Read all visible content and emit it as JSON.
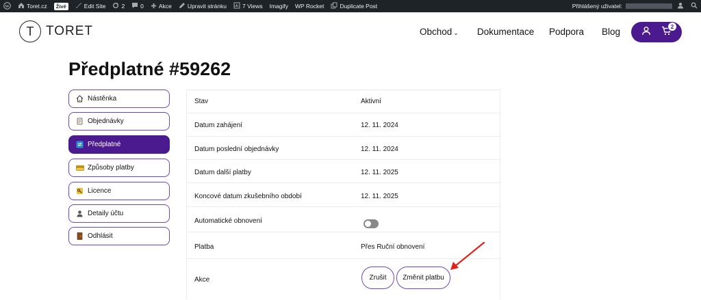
{
  "adminbar": {
    "site_name": "Toret.cz",
    "live_badge": "Živé",
    "edit_site": "Edit Site",
    "updates_count": "2",
    "comments_count": "0",
    "new_label": "Akce",
    "edit_page": "Upravit stránku",
    "views": "7 Views",
    "imagify": "Imagify",
    "wp_rocket": "WP Rocket",
    "duplicate_post": "Duplicate Post",
    "logged_in_label": "Přihlášený uživatel:"
  },
  "header": {
    "logo_letter": "T",
    "logo_text": "TORET",
    "nav": [
      "Obchod",
      "Dokumentace",
      "Podpora",
      "Blog"
    ],
    "cart_count": "2"
  },
  "page_title": "Předplatné #59262",
  "sidenav": {
    "items": [
      {
        "label": "Nástěnka",
        "icon": "house-icon",
        "active": false
      },
      {
        "label": "Objednávky",
        "icon": "scroll-icon",
        "active": false
      },
      {
        "label": "Předplatné",
        "icon": "repeat-icon",
        "active": true
      },
      {
        "label": "Způsoby platby",
        "icon": "credit-card-icon",
        "active": false
      },
      {
        "label": "Licence",
        "icon": "key-icon",
        "active": false
      },
      {
        "label": "Detaily účtu",
        "icon": "user-icon",
        "active": false
      },
      {
        "label": "Odhlásit",
        "icon": "door-icon",
        "active": false
      }
    ]
  },
  "details": {
    "rows": [
      {
        "label": "Stav",
        "value": "Aktivní"
      },
      {
        "label": "Datum zahájení",
        "value": "12. 11. 2024"
      },
      {
        "label": "Datum poslední objednávky",
        "value": "12. 11. 2024"
      },
      {
        "label": "Datum další platby",
        "value": "12. 11. 2025"
      },
      {
        "label": "Koncové datum zkušebního období",
        "value": "12. 11. 2025"
      },
      {
        "label": "Automatické obnovení",
        "value": ""
      },
      {
        "label": "Platba",
        "value": "Přes Ruční obnovení"
      },
      {
        "label": "Akce",
        "value": ""
      }
    ],
    "auto_renew_on": false,
    "actions": {
      "cancel": "Zrušit",
      "change_payment": "Změnit platbu"
    }
  },
  "colors": {
    "accent": "#4b1a8f",
    "border": "#6b46c1",
    "annotation": "#e0201b"
  }
}
